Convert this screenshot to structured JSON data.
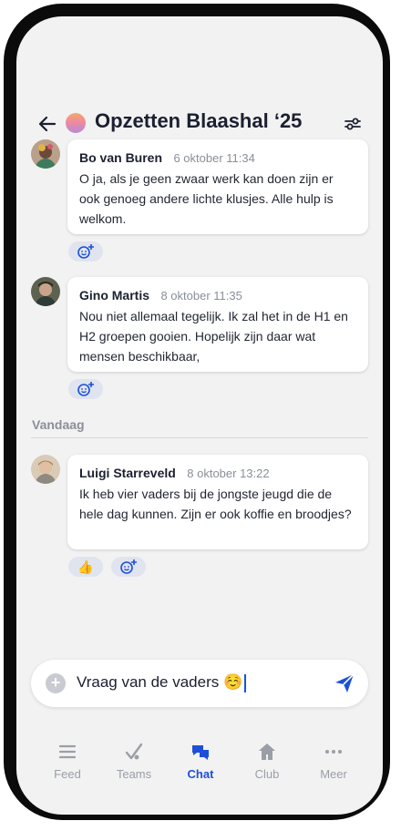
{
  "header": {
    "title": "Opzetten Blaashal ‘25",
    "back_icon": "arrow-left-icon",
    "filter_icon": "sliders-icon"
  },
  "messages": [
    {
      "name": "Bo van Buren",
      "time": "6 oktober 11:34",
      "text": "O ja, als je geen zwaar werk kan doen zijn er ook genoeg andere lichte klusjes. Alle hulp is welkom.",
      "reactions": [
        "add-reaction-icon"
      ]
    },
    {
      "name": "Gino Martis",
      "time": "8 oktober 11:35",
      "text": "Nou niet allemaal tegelijk. Ik zal het in de H1 en H2 groepen gooien. Hopelijk zijn daar wat mensen beschikbaar,",
      "reactions": [
        "add-reaction-icon"
      ]
    },
    {
      "name": "Luigi Starreveld",
      "time": "8 oktober 13:22",
      "text": "Ik heb vier vaders bij de jongste jeugd die de hele dag kunnen. Zijn er ook koffie en broodjes?",
      "reactions": [
        "👍",
        "add-reaction-icon"
      ]
    }
  ],
  "day_separator": "Vandaag",
  "composer": {
    "text": "Vraag van de vaders ☺️"
  },
  "tabs": [
    {
      "label": "Feed",
      "icon": "feed-icon"
    },
    {
      "label": "Teams",
      "icon": "teams-icon"
    },
    {
      "label": "Chat",
      "icon": "chat-icon",
      "active": true
    },
    {
      "label": "Club",
      "icon": "home-icon"
    },
    {
      "label": "Meer",
      "icon": "more-icon"
    }
  ],
  "colors": {
    "accent": "#1e4fd8",
    "background": "#f2f2f2",
    "reaction_bg": "#dfe4ef"
  }
}
